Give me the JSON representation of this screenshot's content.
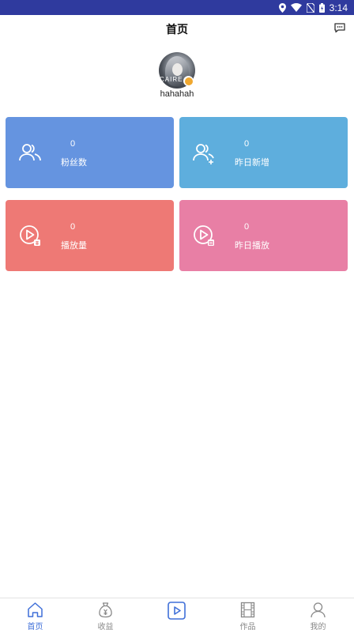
{
  "status_bar": {
    "time": "3:14"
  },
  "header": {
    "title": "首页"
  },
  "profile": {
    "username": "hahahah",
    "avatar_text": "CAIRE"
  },
  "stats": [
    {
      "value": "0",
      "label": "粉丝数",
      "color": "#6594e0",
      "icon": "fans-icon"
    },
    {
      "value": "0",
      "label": "昨日新增",
      "color": "#5eaedd",
      "icon": "new-fans-icon"
    },
    {
      "value": "0",
      "label": "播放量",
      "color": "#ee7975",
      "icon": "play-total-icon"
    },
    {
      "value": "0",
      "label": "昨日播放",
      "color": "#e87fa5",
      "icon": "play-yesterday-icon"
    }
  ],
  "tabs": [
    {
      "label": "首页",
      "icon": "home-icon",
      "active": true
    },
    {
      "label": "收益",
      "icon": "money-bag-icon",
      "active": false
    },
    {
      "label": "",
      "icon": "publish-video-icon",
      "active": false
    },
    {
      "label": "作品",
      "icon": "film-icon",
      "active": false
    },
    {
      "label": "我的",
      "icon": "user-icon",
      "active": false
    }
  ],
  "colors": {
    "accent": "#3f6fd8",
    "status_bar": "#2f3a9e",
    "tab_inactive": "#888888"
  }
}
